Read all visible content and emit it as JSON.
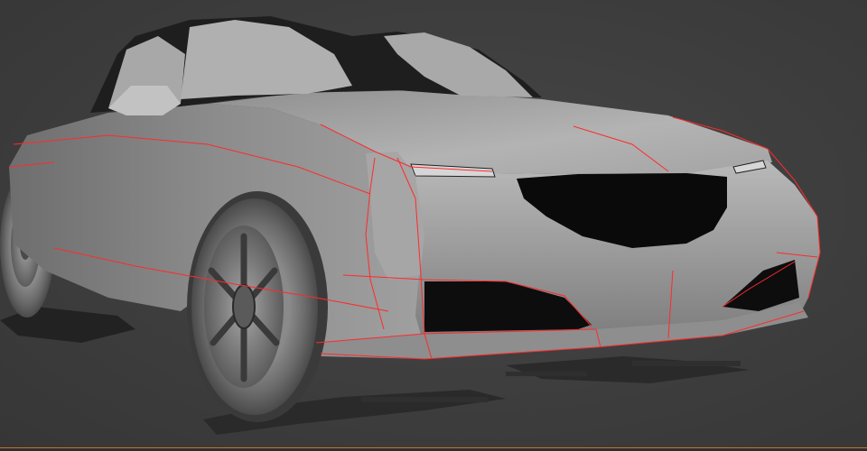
{
  "viewport": {
    "background_color": "#3f3f3f",
    "edge_highlight_color": "#c07a28",
    "model": {
      "subject": "3d-scanned-car-front",
      "surface_color": "#9e9e9e",
      "wireframe_color": "#ff2a2a"
    }
  }
}
